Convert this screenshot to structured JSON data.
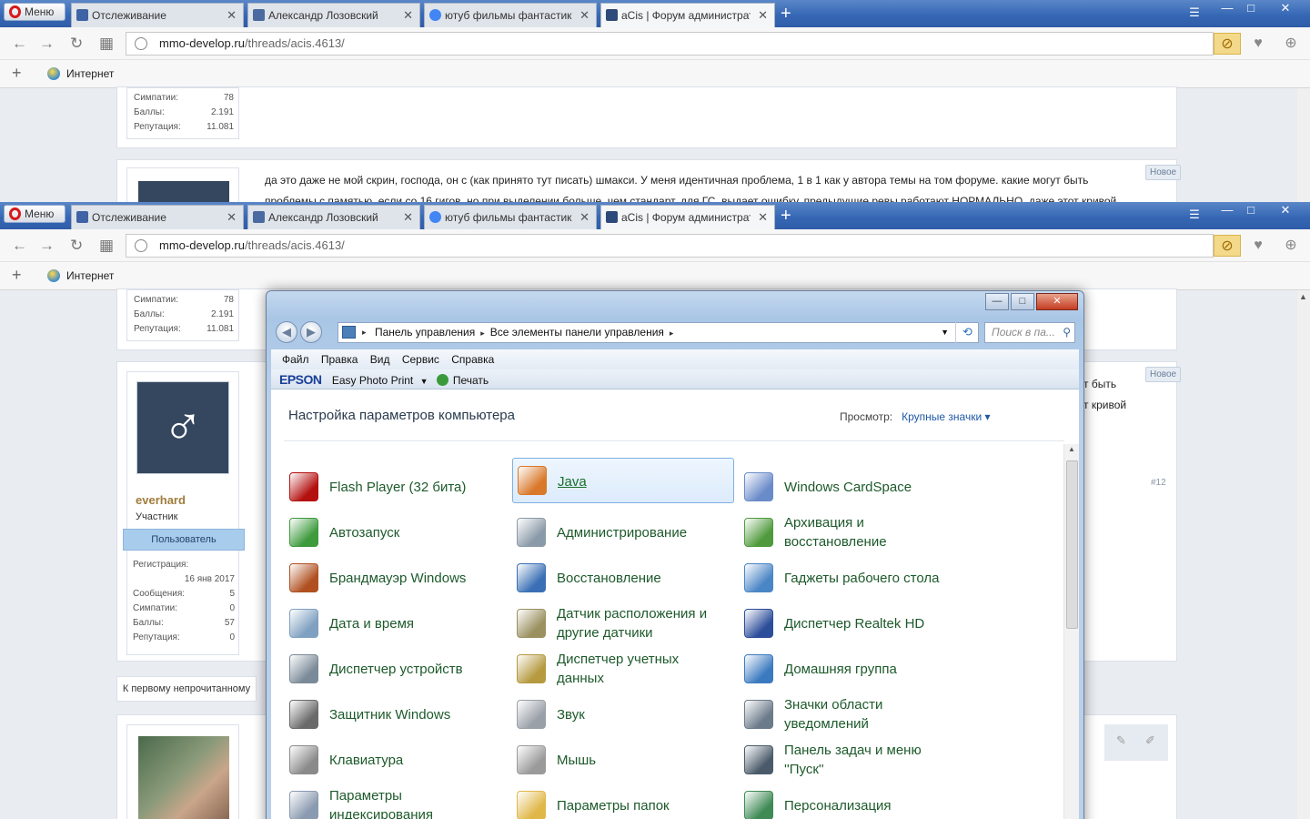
{
  "browser": {
    "menu_label": "Меню",
    "tabs": [
      {
        "label": "Отслеживание",
        "favicon_color": "#3f63a4"
      },
      {
        "label": "Александр Лозовский",
        "favicon_color": "#4a6aa0"
      },
      {
        "label": "ютуб фильмы фантастика",
        "favicon_color": "#4285f4"
      },
      {
        "label": "aCis | Форум администрат",
        "favicon_color": "#2e4a7a"
      }
    ],
    "address": {
      "domain": "mmo-develop.ru",
      "path": "/threads/acis.4613/"
    },
    "bookmark": "Интернет",
    "window_controls": [
      "—",
      "□",
      "✕"
    ]
  },
  "forum": {
    "top_stats": [
      {
        "label": "Симпатии:",
        "value": "78"
      },
      {
        "label": "Баллы:",
        "value": "2.191"
      },
      {
        "label": "Репутация:",
        "value": "11.081"
      }
    ],
    "post_text": "да это даже не мой скрин, господа, он с (как принято тут писать) шмакси. У меня идентичная проблема, 1 в 1 как у автора темы на том форуме. какие могут быть",
    "post_text_2": "проблемы с памятью, если со 16 гигов, но при выделении больше, чем стандарт, для ГС, выдает ошибку. предыдущие ревы работают НОРМАЛЬНО, даже этот кривой",
    "new_badge": "Новое",
    "tail_text_1": "т быть",
    "tail_text_2": "т кривой",
    "post_num": "#12",
    "user": {
      "name": "everhard",
      "role": "Участник",
      "badge": "Пользователь",
      "stats": [
        {
          "label": "Регистрация:",
          "value": "16 янв 2017"
        },
        {
          "label": "Сообщения:",
          "value": "5"
        },
        {
          "label": "Симпатии:",
          "value": "0"
        },
        {
          "label": "Баллы:",
          "value": "57"
        },
        {
          "label": "Репутация:",
          "value": "0"
        }
      ]
    },
    "first_unread": "К первому непрочитанному"
  },
  "control_panel": {
    "breadcrumb": [
      "Панель управления",
      "Все элементы панели управления"
    ],
    "search_placeholder": "Поиск в па...",
    "menu": [
      "Файл",
      "Правка",
      "Вид",
      "Сервис",
      "Справка"
    ],
    "toolbar": {
      "brand": "EPSON",
      "photo": "Easy Photo Print",
      "print": "Печать"
    },
    "title": "Настройка параметров компьютера",
    "view_label": "Просмотр:",
    "view_value": "Крупные значки",
    "items": [
      {
        "label": "Flash Player (32 бита)",
        "icon": "flash-icon",
        "color": "#b3110f"
      },
      {
        "label": "Java",
        "icon": "java-icon",
        "color": "#d9782a"
      },
      {
        "label": "Windows CardSpace",
        "icon": "cardspace-icon",
        "color": "#6a8bc9"
      },
      {
        "label": "Автозапуск",
        "icon": "autoplay-icon",
        "color": "#3d9a3d"
      },
      {
        "label": "Администрирование",
        "icon": "admin-tools-icon",
        "color": "#8a9aa8"
      },
      {
        "label": "Архивация и восстановление",
        "icon": "backup-icon",
        "color": "#4f9a3c"
      },
      {
        "label": "Брандмауэр Windows",
        "icon": "firewall-icon",
        "color": "#b05020"
      },
      {
        "label": "Восстановление",
        "icon": "recovery-icon",
        "color": "#3a6fb5"
      },
      {
        "label": "Гаджеты рабочего стола",
        "icon": "gadgets-icon",
        "color": "#4a85c5"
      },
      {
        "label": "Дата и время",
        "icon": "clock-icon",
        "color": "#7fa0c0"
      },
      {
        "label": "Датчик расположения и другие датчики",
        "icon": "sensor-icon",
        "color": "#9a9060"
      },
      {
        "label": "Диспетчер Realtek HD",
        "icon": "realtek-icon",
        "color": "#2c4d9a"
      },
      {
        "label": "Диспетчер устройств",
        "icon": "device-manager-icon",
        "color": "#7a8a98"
      },
      {
        "label": "Диспетчер учетных данных",
        "icon": "credentials-icon",
        "color": "#b59a40"
      },
      {
        "label": "Домашняя группа",
        "icon": "homegroup-icon",
        "color": "#3c7ac0"
      },
      {
        "label": "Защитник Windows",
        "icon": "defender-icon",
        "color": "#6a6a6a"
      },
      {
        "label": "Звук",
        "icon": "speaker-icon",
        "color": "#9aa0a8"
      },
      {
        "label": "Значки области уведомлений",
        "icon": "tray-icon",
        "color": "#6c7b8a"
      },
      {
        "label": "Клавиатура",
        "icon": "keyboard-icon",
        "color": "#8a8a8a"
      },
      {
        "label": "Мышь",
        "icon": "mouse-icon",
        "color": "#9a9a9a"
      },
      {
        "label": "Панель задач и меню ''Пуск''",
        "icon": "taskbar-icon",
        "color": "#4a5a6a"
      },
      {
        "label": "Параметры индексирования",
        "icon": "indexing-icon",
        "color": "#8a9ab0"
      },
      {
        "label": "Параметры папок",
        "icon": "folder-icon",
        "color": "#e0b84a"
      },
      {
        "label": "Персонализация",
        "icon": "personalization-icon",
        "color": "#3f8a55"
      }
    ]
  }
}
